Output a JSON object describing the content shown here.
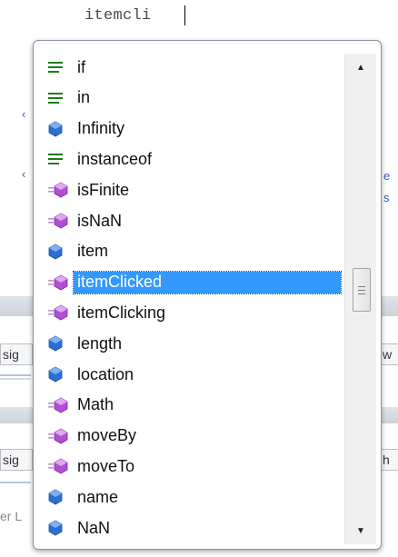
{
  "editor": {
    "typed_text": "itemcli",
    "fragments": [
      "e",
      "s",
      "sig",
      "w",
      "sig",
      "h",
      "er L"
    ]
  },
  "completion": {
    "items": [
      {
        "label": "if",
        "icon": "keyword-icon"
      },
      {
        "label": "in",
        "icon": "keyword-icon"
      },
      {
        "label": "Infinity",
        "icon": "property-icon"
      },
      {
        "label": "instanceof",
        "icon": "keyword-icon"
      },
      {
        "label": "isFinite",
        "icon": "method-icon"
      },
      {
        "label": "isNaN",
        "icon": "method-icon"
      },
      {
        "label": "item",
        "icon": "property-icon"
      },
      {
        "label": "itemClicked",
        "icon": "method-icon",
        "selected": true
      },
      {
        "label": "itemClicking",
        "icon": "method-icon"
      },
      {
        "label": "length",
        "icon": "property-icon"
      },
      {
        "label": "location",
        "icon": "property-icon"
      },
      {
        "label": "Math",
        "icon": "method-icon"
      },
      {
        "label": "moveBy",
        "icon": "method-icon"
      },
      {
        "label": "moveTo",
        "icon": "method-icon"
      },
      {
        "label": "name",
        "icon": "property-icon"
      },
      {
        "label": "NaN",
        "icon": "property-icon"
      }
    ],
    "colors": {
      "selection": "#3399ff",
      "keyword": "#1f7a1f",
      "property": "#2d6fd1",
      "method": "#b04fd1"
    }
  }
}
